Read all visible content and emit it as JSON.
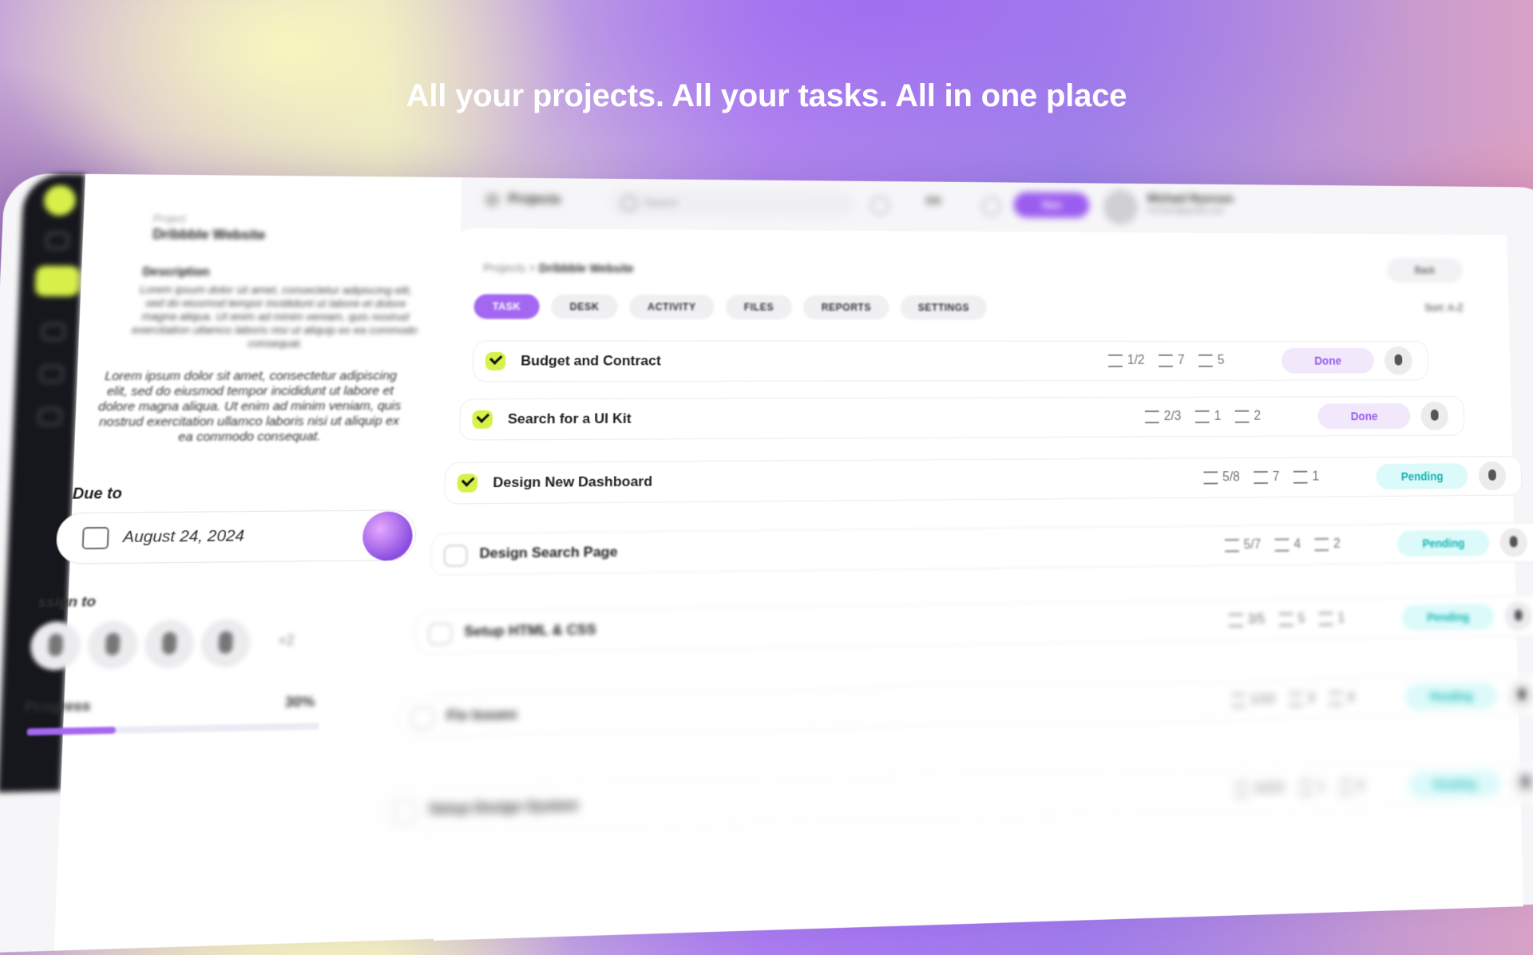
{
  "headline": "All your projects. All your tasks. All in one place",
  "colors": {
    "accent": "#a467f2",
    "lime": "#d8f04a",
    "done_text": "#9b5cf0",
    "pending_text": "#18b3b3"
  },
  "left_panel": {
    "project_label": "Project",
    "project_name": "Dribbble Website",
    "description_title": "Description",
    "description_1": "Lorem ipsum dolor sit amet, consectetur adipiscing elit, sed do eiusmod tempor incididunt ut labore et dolore magna aliqua. Ut enim ad minim veniam, quis nostrud exercitation ullamco laboris nisi ut aliquip ex ea commodo consequat.",
    "description_2": "Lorem ipsum dolor sit amet, consectetur adipiscing elit, sed do eiusmod tempor incididunt ut labore et dolore magna aliqua. Ut enim ad minim veniam, quis nostrud exercitation ullamco laboris nisi ut aliquip ex ea commodo consequat.",
    "due_label": "Due to",
    "due_date": "August 24, 2024",
    "assign_label": "ssign to",
    "assign_more": "+2",
    "progress_label": "Progress",
    "progress_value": "30%",
    "progress_fraction": 0.3
  },
  "topbar": {
    "section": "Projects",
    "search_placeholder": "Search",
    "language": "EN",
    "new_button": "New",
    "user_name": "Michael Ryerson",
    "user_email": "michael@gmail.com"
  },
  "board": {
    "breadcrumb_root": "Projects",
    "breadcrumb_sep": ">",
    "breadcrumb_current": "Dribbble Website",
    "back_label": "Back",
    "sort_label": "Sort: A-Z",
    "tabs": [
      "TASK",
      "DESK",
      "ACTIVITY",
      "FILES",
      "REPORTS",
      "SETTINGS"
    ],
    "tasks": [
      {
        "name": "Budget and Contract",
        "subtasks": "1/2",
        "links": "7",
        "comments": "5",
        "status": "Done",
        "checked": true
      },
      {
        "name": "Search for a UI Kit",
        "subtasks": "2/3",
        "links": "1",
        "comments": "2",
        "status": "Done",
        "checked": true
      },
      {
        "name": "Design New Dashboard",
        "subtasks": "5/8",
        "links": "7",
        "comments": "1",
        "status": "Pending",
        "checked": true
      },
      {
        "name": "Design Search Page",
        "subtasks": "5/7",
        "links": "4",
        "comments": "2",
        "status": "Pending",
        "checked": false
      },
      {
        "name": "Setup HTML & CSS",
        "subtasks": "3/5",
        "links": "5",
        "comments": "1",
        "status": "Pending",
        "checked": false
      },
      {
        "name": "Fix Issues",
        "subtasks": "1/10",
        "links": "3",
        "comments": "4",
        "status": "Pending",
        "checked": false
      },
      {
        "name": "Setup Design System",
        "subtasks": "10/20",
        "links": "1",
        "comments": "5",
        "status": "Pending",
        "checked": false
      }
    ]
  }
}
